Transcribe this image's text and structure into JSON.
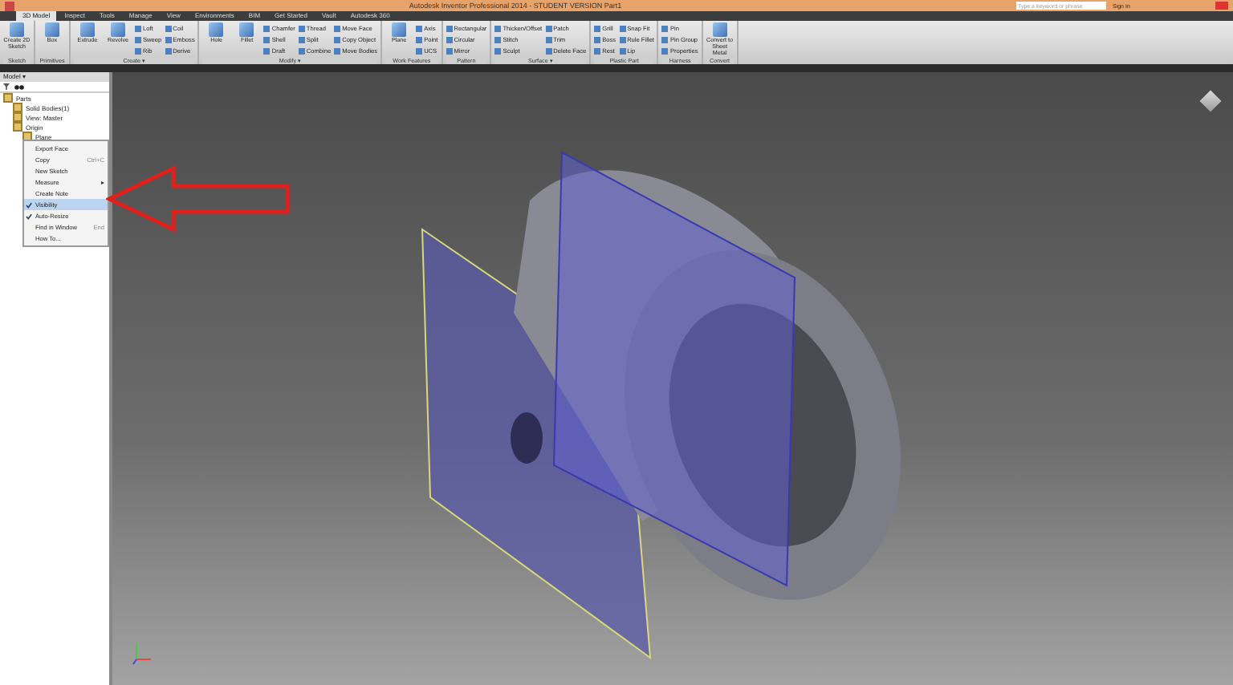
{
  "window": {
    "title": "Autodesk Inventor Professional 2014 - STUDENT VERSION   Part1"
  },
  "search": {
    "placeholder": "Type a keyword or phrase"
  },
  "sign_in": "Sign In",
  "tabs": [
    {
      "label": "3D Model",
      "selected": true
    },
    {
      "label": "Inspect",
      "selected": false
    },
    {
      "label": "Tools",
      "selected": false
    },
    {
      "label": "Manage",
      "selected": false
    },
    {
      "label": "View",
      "selected": false
    },
    {
      "label": "Environments",
      "selected": false
    },
    {
      "label": "BIM",
      "selected": false
    },
    {
      "label": "Get Started",
      "selected": false
    },
    {
      "label": "Vault",
      "selected": false
    },
    {
      "label": "Autodesk 360",
      "selected": false
    }
  ],
  "ribbon": [
    {
      "label": "Sketch",
      "buttons": [
        {
          "kind": "large",
          "label": "Create 2D Sketch"
        }
      ]
    },
    {
      "label": "Primitives",
      "buttons": [
        {
          "kind": "large",
          "label": "Box"
        }
      ]
    },
    {
      "label": "Create ▾",
      "buttons": [
        {
          "kind": "large",
          "label": "Extrude"
        },
        {
          "kind": "large",
          "label": "Revolve"
        },
        {
          "kind": "small",
          "label": "Loft"
        },
        {
          "kind": "small",
          "label": "Sweep"
        },
        {
          "kind": "small",
          "label": "Rib"
        },
        {
          "kind": "small",
          "label": "Coil"
        },
        {
          "kind": "small",
          "label": "Emboss"
        },
        {
          "kind": "small",
          "label": "Derive"
        }
      ]
    },
    {
      "label": "Modify ▾",
      "buttons": [
        {
          "kind": "large",
          "label": "Hole"
        },
        {
          "kind": "large",
          "label": "Fillet"
        },
        {
          "kind": "small",
          "label": "Chamfer"
        },
        {
          "kind": "small",
          "label": "Shell"
        },
        {
          "kind": "small",
          "label": "Draft"
        },
        {
          "kind": "small",
          "label": "Thread"
        },
        {
          "kind": "small",
          "label": "Split"
        },
        {
          "kind": "small",
          "label": "Combine"
        },
        {
          "kind": "small",
          "label": "Move Face"
        },
        {
          "kind": "small",
          "label": "Copy Object"
        },
        {
          "kind": "small",
          "label": "Move Bodies"
        }
      ]
    },
    {
      "label": "Work Features",
      "buttons": [
        {
          "kind": "large",
          "label": "Plane"
        },
        {
          "kind": "small",
          "label": "Axis"
        },
        {
          "kind": "small",
          "label": "Point"
        },
        {
          "kind": "small",
          "label": "UCS"
        }
      ]
    },
    {
      "label": "Pattern",
      "buttons": [
        {
          "kind": "small",
          "label": "Rectangular"
        },
        {
          "kind": "small",
          "label": "Circular"
        },
        {
          "kind": "small",
          "label": "Mirror"
        }
      ]
    },
    {
      "label": "Surface ▾",
      "buttons": [
        {
          "kind": "small",
          "label": "Thicken/Offset"
        },
        {
          "kind": "small",
          "label": "Stitch"
        },
        {
          "kind": "small",
          "label": "Sculpt"
        },
        {
          "kind": "small",
          "label": "Patch"
        },
        {
          "kind": "small",
          "label": "Trim"
        },
        {
          "kind": "small",
          "label": "Delete Face"
        }
      ]
    },
    {
      "label": "Plastic Part",
      "buttons": [
        {
          "kind": "small",
          "label": "Grill"
        },
        {
          "kind": "small",
          "label": "Boss"
        },
        {
          "kind": "small",
          "label": "Rest"
        },
        {
          "kind": "small",
          "label": "Snap Fit"
        },
        {
          "kind": "small",
          "label": "Rule Fillet"
        },
        {
          "kind": "small",
          "label": "Lip"
        }
      ]
    },
    {
      "label": "Harness",
      "buttons": [
        {
          "kind": "small",
          "label": "Pin"
        },
        {
          "kind": "small",
          "label": "Pin Group"
        },
        {
          "kind": "small",
          "label": "Properties"
        }
      ]
    },
    {
      "label": "Convert",
      "buttons": [
        {
          "kind": "large",
          "label": "Convert to Sheet Metal"
        }
      ]
    }
  ],
  "browser": {
    "title": "Model ▾",
    "tree": [
      {
        "label": "Parts",
        "children": [
          {
            "label": "Solid Bodies(1)"
          },
          {
            "label": "View: Master"
          },
          {
            "label": "Origin",
            "children": [
              {
                "label": "Plane"
              }
            ]
          }
        ]
      }
    ]
  },
  "context_menu": [
    {
      "label": "Export Face",
      "checked": false,
      "selected": false
    },
    {
      "label": "Copy",
      "shortcut": "Ctrl+C",
      "checked": false,
      "selected": false
    },
    {
      "label": "New Sketch",
      "checked": false,
      "selected": false
    },
    {
      "label": "Measure",
      "submenu": true,
      "checked": false,
      "selected": false
    },
    {
      "label": "Create Note",
      "checked": false,
      "selected": false
    },
    {
      "label": "Visibility",
      "checked": true,
      "selected": true
    },
    {
      "label": "Auto-Resize",
      "checked": true,
      "selected": false
    },
    {
      "label": "Find in Window",
      "shortcut": "End",
      "checked": false,
      "selected": false
    },
    {
      "label": "How To...",
      "checked": false,
      "selected": false
    }
  ]
}
